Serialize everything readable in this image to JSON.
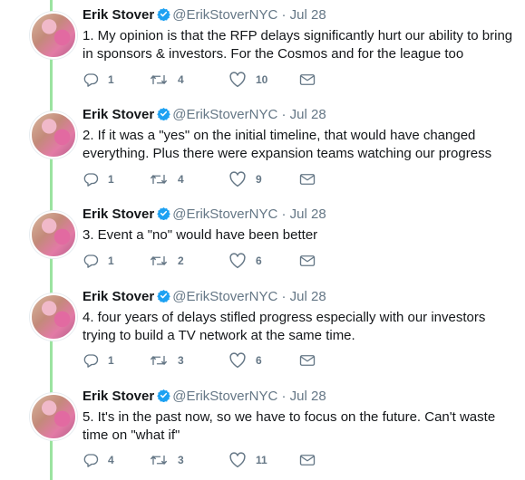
{
  "author": {
    "name": "Erik Stover",
    "handle": "@ErikStoverNYC",
    "separator": "·",
    "verified_icon": "verified-badge-icon"
  },
  "colors": {
    "thread_line": "#9be3a0",
    "verified": "#1da1f2",
    "muted": "#657786",
    "text": "#14171a"
  },
  "tweets": [
    {
      "date": "Jul 28",
      "text": "1. My opinion is that the RFP delays significantly hurt our ability to bring in sponsors & investors. For the Cosmos and for the league too",
      "replies": "1",
      "retweets": "4",
      "likes": "10"
    },
    {
      "date": "Jul 28",
      "text": "2. If it was a \"yes\" on the initial timeline, that would have changed everything. Plus there were expansion teams watching our progress",
      "replies": "1",
      "retweets": "4",
      "likes": "9"
    },
    {
      "date": "Jul 28",
      "text": "3. Event a \"no\" would have been better",
      "replies": "1",
      "retweets": "2",
      "likes": "6"
    },
    {
      "date": "Jul 28",
      "text": "4. four years of delays stifled progress especially with our investors trying to build a TV network at the same time.",
      "replies": "1",
      "retweets": "3",
      "likes": "6"
    },
    {
      "date": "Jul 28",
      "text": "5. It's in the past now, so we have to focus on the future. Can't waste time on \"what if\"",
      "replies": "4",
      "retweets": "3",
      "likes": "11"
    }
  ]
}
